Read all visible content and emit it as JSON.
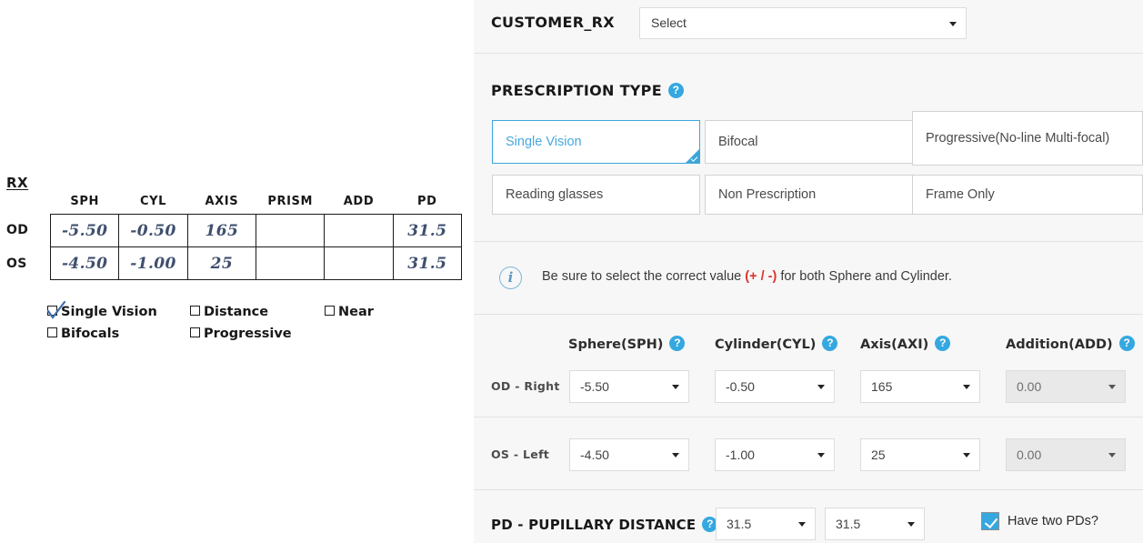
{
  "rx_scan": {
    "title": "RX",
    "columns": [
      "SPH",
      "CYL",
      "AXIS",
      "PRISM",
      "ADD",
      "PD"
    ],
    "rows": [
      {
        "eye": "OD",
        "sph": "-5.50",
        "cyl": "-0.50",
        "axis": "165",
        "prism": "",
        "add": "",
        "pd": "31.5"
      },
      {
        "eye": "OS",
        "sph": "-4.50",
        "cyl": "-1.00",
        "axis": "25",
        "prism": "",
        "add": "",
        "pd": "31.5"
      }
    ],
    "options": [
      {
        "label": "Single Vision",
        "checked": true
      },
      {
        "label": "Distance",
        "checked": false
      },
      {
        "label": "Near",
        "checked": false
      },
      {
        "label": "Bifocals",
        "checked": false
      },
      {
        "label": "Progressive",
        "checked": false
      }
    ]
  },
  "customer_rx": {
    "title": "CUSTOMER_RX",
    "select_value": "Select"
  },
  "prescription_type": {
    "title": "PRESCRIPTION TYPE",
    "help_glyph": "?",
    "options": [
      {
        "label": "Single Vision",
        "selected": true
      },
      {
        "label": "Bifocal",
        "selected": false
      },
      {
        "label": "Progressive(No-line Multi-focal)",
        "selected": false
      },
      {
        "label": "Reading glasses",
        "selected": false
      },
      {
        "label": "Non Prescription",
        "selected": false
      },
      {
        "label": "Frame Only",
        "selected": false
      }
    ]
  },
  "notice": {
    "icon_glyph": "i",
    "text_before": "Be sure to select the correct value ",
    "highlight": "(+ / -)",
    "text_after": " for both Sphere and Cylinder."
  },
  "rx_form": {
    "columns": [
      {
        "label": "Sphere(SPH)",
        "help_glyph": "?"
      },
      {
        "label": "Cylinder(CYL)",
        "help_glyph": "?"
      },
      {
        "label": "Axis(AXI)",
        "help_glyph": "?"
      },
      {
        "label": "Addition(ADD)",
        "help_glyph": "?"
      }
    ],
    "rows": [
      {
        "eye_label": "OD - Right",
        "sph": "-5.50",
        "cyl": "-0.50",
        "axi": "165",
        "add": "0.00",
        "add_disabled": true
      },
      {
        "eye_label": "OS - Left",
        "sph": "-4.50",
        "cyl": "-1.00",
        "axi": "25",
        "add": "0.00",
        "add_disabled": true
      }
    ]
  },
  "pd_section": {
    "title": "PD - PUPILLARY DISTANCE",
    "help_glyph": "?",
    "pd_right": "31.5",
    "pd_left": "31.5",
    "two_pds_label": "Have two PDs?",
    "two_pds_checked": true
  },
  "colors": {
    "accent_blue": "#35a8e0",
    "selected_border": "#39a7dc",
    "panel_bg": "#f7f7f7",
    "warning_red": "#e0332e",
    "handwriting": "#3f4f6e"
  }
}
